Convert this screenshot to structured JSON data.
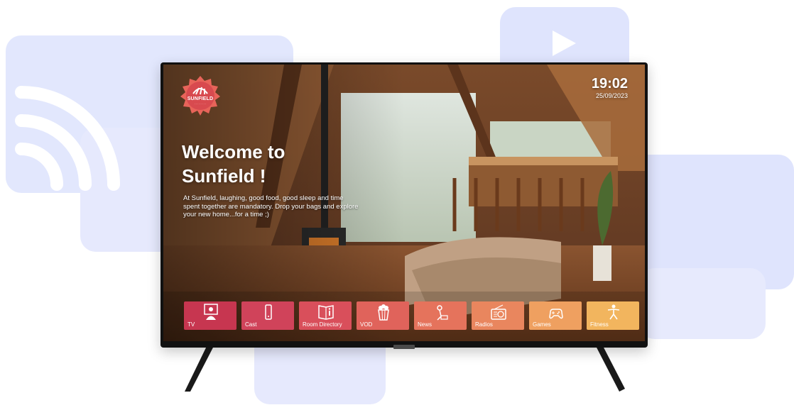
{
  "tv": {
    "brand_logo": {
      "name": "SUNFIELD"
    },
    "clock": {
      "time": "19:02",
      "date": "25/09/2023"
    },
    "welcome": {
      "title_line1": "Welcome to",
      "title_line2": "Sunfield !"
    },
    "description": "At Sunfield, laughing, good food, good sleep and time spent together are mandatory. Drop your bags and explore your new home...for a time ;)",
    "menu": [
      {
        "label": "TV",
        "icon": "tv-person-icon",
        "color": "#c73650"
      },
      {
        "label": "Cast",
        "icon": "cast-phone-icon",
        "color": "#d0435a"
      },
      {
        "label": "Room Directory",
        "icon": "book-info-icon",
        "color": "#d94f5b"
      },
      {
        "label": "VOD",
        "icon": "popcorn-icon",
        "color": "#e0635b"
      },
      {
        "label": "News",
        "icon": "news-person-icon",
        "color": "#e5735c"
      },
      {
        "label": "Radios",
        "icon": "radio-icon",
        "color": "#e9865e"
      },
      {
        "label": "Games",
        "icon": "gamepad-icon",
        "color": "#efa060"
      },
      {
        "label": "Fitness",
        "icon": "fitness-person-icon",
        "color": "#f2b55e"
      }
    ]
  },
  "decorations": {
    "wifi_icon": "wifi-icon",
    "play_icon": "play-icon"
  }
}
